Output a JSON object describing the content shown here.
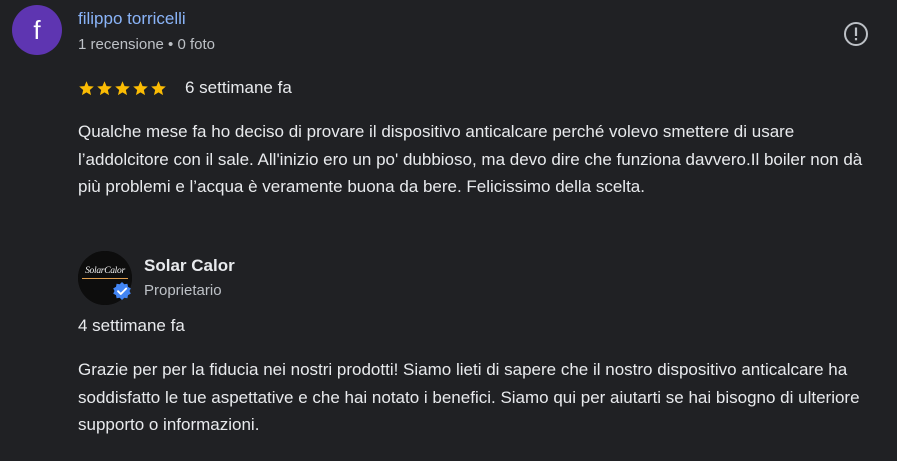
{
  "review": {
    "avatar_letter": "f",
    "avatar_color": "#5e35b1",
    "author_name": "filippo torricelli",
    "author_meta": "1 recensione • 0 foto",
    "rating": 5,
    "rating_max": 5,
    "star_color": "#fbbc04",
    "time": "6 settimane fa",
    "text": "Qualche mese fa ho deciso di provare il dispositivo anticalcare perché volevo smettere di usare l’addolcitore con il sale. All'inizio ero un po' dubbioso, ma devo dire che funziona davvero.Il boiler non dà più problemi e l’acqua è veramente buona da bere. Felicissimo della scelta.",
    "report_icon": "report-icon"
  },
  "owner_reply": {
    "logo_text": "SolarCalor",
    "owner_name": "Solar Calor",
    "owner_role": "Proprietario",
    "verified_icon": "verified-badge-icon",
    "verified_color": "#4285f4",
    "time": "4 settimane fa",
    "text": "Grazie per per la fiducia nei nostri prodotti! Siamo lieti di sapere che il nostro dispositivo anticalcare ha soddisfatto le tue aspettative e che hai notato i benefici. Siamo qui per aiutarti se hai bisogno di ulteriore supporto o informazioni."
  }
}
